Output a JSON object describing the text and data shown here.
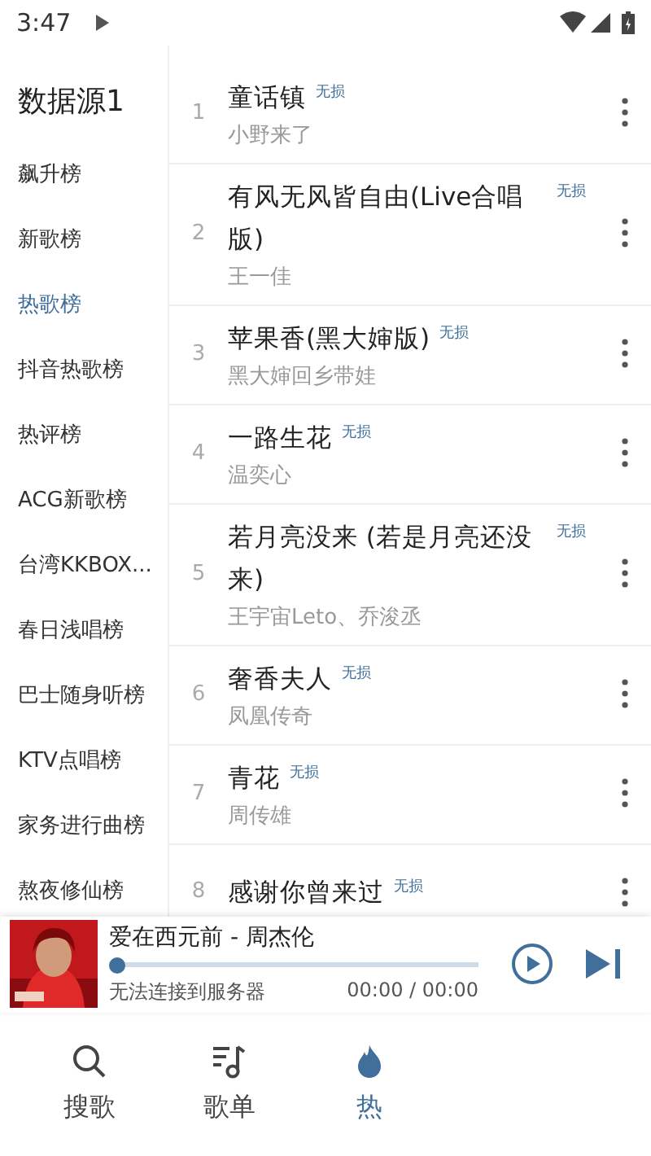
{
  "status_bar": {
    "time": "3:47"
  },
  "sidebar": {
    "title": "数据源1",
    "items": [
      {
        "label": "飙升榜",
        "selected": false
      },
      {
        "label": "新歌榜",
        "selected": false
      },
      {
        "label": "热歌榜",
        "selected": true
      },
      {
        "label": "抖音热歌榜",
        "selected": false
      },
      {
        "label": "热评榜",
        "selected": false
      },
      {
        "label": "ACG新歌榜",
        "selected": false
      },
      {
        "label": "台湾KKBOX...",
        "selected": false
      },
      {
        "label": "春日浅唱榜",
        "selected": false
      },
      {
        "label": "巴士随身听榜",
        "selected": false
      },
      {
        "label": "KTV点唱榜",
        "selected": false
      },
      {
        "label": "家务进行曲榜",
        "selected": false
      },
      {
        "label": "熬夜修仙榜",
        "selected": false
      }
    ]
  },
  "songs": [
    {
      "rank": "1",
      "title": "童话镇",
      "tag": "无损",
      "artist": "小野来了"
    },
    {
      "rank": "2",
      "title": "有风无风皆自由(Live合唱版)",
      "tag": "无损",
      "artist": "王一佳"
    },
    {
      "rank": "3",
      "title": "苹果香(黑大婶版)",
      "tag": "无损",
      "artist": "黑大婶回乡带娃"
    },
    {
      "rank": "4",
      "title": "一路生花",
      "tag": "无损",
      "artist": "温奕心"
    },
    {
      "rank": "5",
      "title": "若月亮没来 (若是月亮还没来)",
      "tag": "无损",
      "artist": "王宇宙Leto、乔浚丞"
    },
    {
      "rank": "6",
      "title": "奢香夫人",
      "tag": "无损",
      "artist": "凤凰传奇"
    },
    {
      "rank": "7",
      "title": "青花",
      "tag": "无损",
      "artist": "周传雄"
    },
    {
      "rank": "8",
      "title": "感谢你曾来过",
      "tag": "无损"
    }
  ],
  "player": {
    "title": "爱在西元前 - 周杰伦",
    "status": "无法连接到服务器",
    "time": "00:00 / 00:00",
    "level": 0
  },
  "nav": [
    {
      "label": "搜歌",
      "selected": false
    },
    {
      "label": "歌单",
      "selected": false
    },
    {
      "label": "热",
      "selected": true
    }
  ]
}
